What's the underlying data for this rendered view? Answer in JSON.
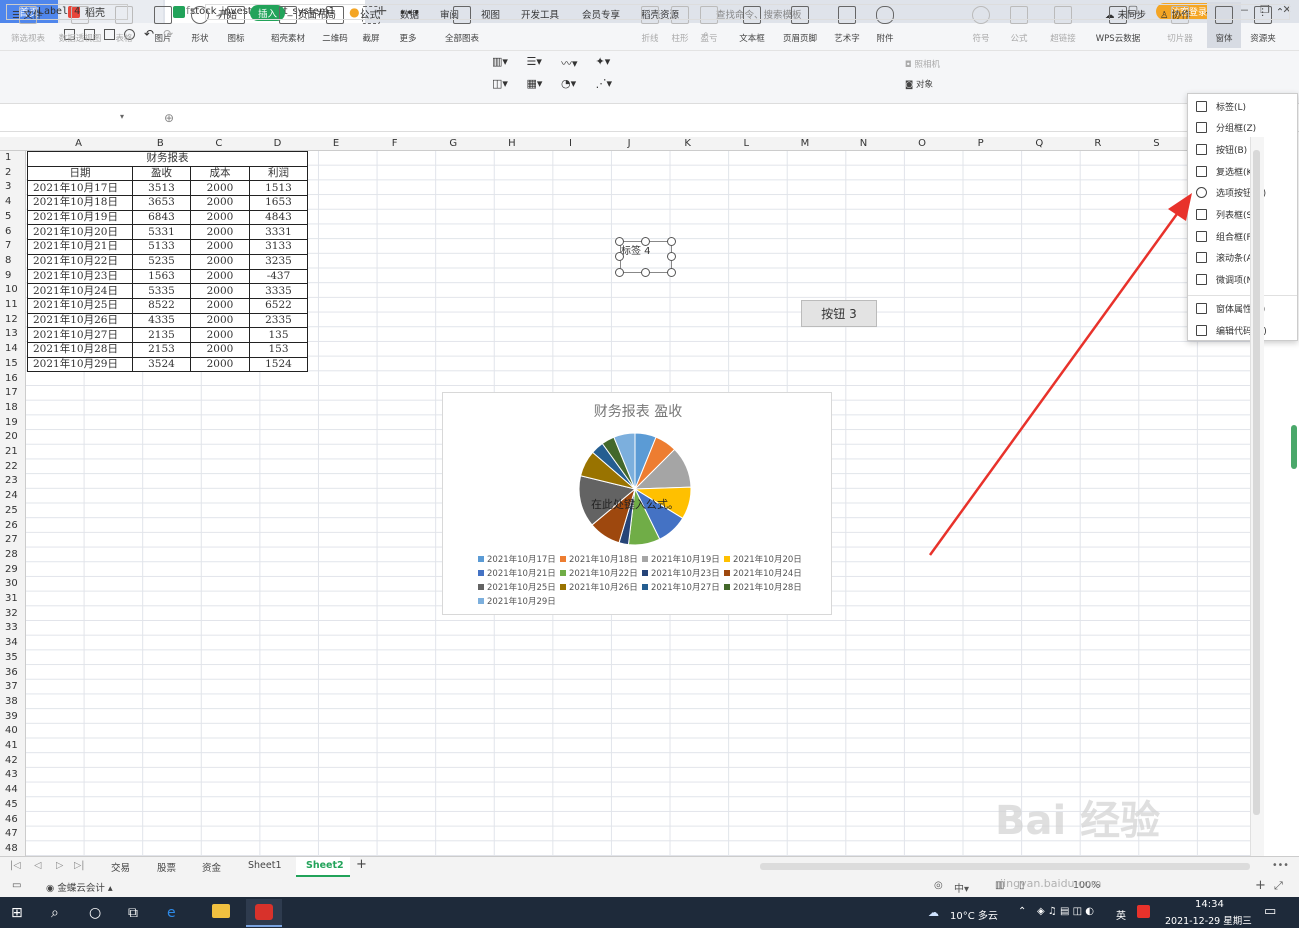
{
  "titlebar": {
    "tabs": [
      "首页",
      "稻壳",
      "stock_invest...ment_system1"
    ],
    "add": "+",
    "login": "访客登录",
    "win_controls": [
      "▢",
      "—",
      "❐",
      "✕"
    ]
  },
  "menubar": {
    "file": "☰ 文件",
    "items": [
      "开始",
      "插入",
      "页面布局",
      "公式",
      "数据",
      "审阅",
      "视图",
      "开发工具",
      "会员专享",
      "稻壳资源"
    ],
    "search": "查找命令、搜索模板",
    "right": [
      "未同步",
      "协作",
      "分享"
    ]
  },
  "ribbon": {
    "items": [
      "筛选视表",
      "数据透视图",
      "表格",
      "图片",
      "形状",
      "图标",
      "稻壳素材",
      "二维码",
      "截屏",
      "更多",
      "全部图表",
      "折线",
      "柱形",
      "盈亏",
      "文本框",
      "页眉页脚",
      "艺术字",
      "附件",
      "对象",
      "符号",
      "公式",
      "超链接",
      "WPS云数据",
      "切片器",
      "窗体",
      "资源夹"
    ],
    "camera": "照相机"
  },
  "formula_bar": {
    "name_box": "Label 4",
    "fx": "fx",
    "zoom_icon": "⊕"
  },
  "columns": [
    "A",
    "B",
    "C",
    "D",
    "E",
    "F",
    "G",
    "H",
    "I",
    "J",
    "K",
    "L",
    "M",
    "N",
    "O",
    "P",
    "Q",
    "R",
    "S"
  ],
  "rows": [
    "1",
    "2",
    "3",
    "4",
    "5",
    "6",
    "7",
    "8",
    "9",
    "10",
    "11",
    "12",
    "13",
    "14",
    "15",
    "16",
    "17",
    "18",
    "19",
    "20",
    "21",
    "22",
    "23",
    "24",
    "25",
    "26",
    "27",
    "28",
    "29",
    "30",
    "31",
    "32",
    "33",
    "34",
    "35",
    "36",
    "37",
    "38",
    "39",
    "40",
    "41",
    "42",
    "43",
    "44",
    "45",
    "46",
    "47",
    "48"
  ],
  "table": {
    "title": "财务报表",
    "headers": [
      "日期",
      "盈收",
      "成本",
      "利润"
    ],
    "rows": [
      [
        "2021年10月17日",
        "3513",
        "2000",
        "1513"
      ],
      [
        "2021年10月18日",
        "3653",
        "2000",
        "1653"
      ],
      [
        "2021年10月19日",
        "6843",
        "2000",
        "4843"
      ],
      [
        "2021年10月20日",
        "5331",
        "2000",
        "3331"
      ],
      [
        "2021年10月21日",
        "5133",
        "2000",
        "3133"
      ],
      [
        "2021年10月22日",
        "5235",
        "2000",
        "3235"
      ],
      [
        "2021年10月23日",
        "1563",
        "2000",
        "-437"
      ],
      [
        "2021年10月24日",
        "5335",
        "2000",
        "3335"
      ],
      [
        "2021年10月25日",
        "8522",
        "2000",
        "6522"
      ],
      [
        "2021年10月26日",
        "4335",
        "2000",
        "2335"
      ],
      [
        "2021年10月27日",
        "2135",
        "2000",
        "135"
      ],
      [
        "2021年10月28日",
        "2153",
        "2000",
        "153"
      ],
      [
        "2021年10月29日",
        "3524",
        "2000",
        "1524"
      ]
    ]
  },
  "controls": {
    "label4": "标签 4",
    "button3": "按钮 3"
  },
  "chart_data": {
    "type": "pie",
    "title": "财务报表 盈收",
    "annotation": "在此处键入公式。",
    "categories": [
      "2021年10月17日",
      "2021年10月18日",
      "2021年10月19日",
      "2021年10月20日",
      "2021年10月21日",
      "2021年10月22日",
      "2021年10月23日",
      "2021年10月24日",
      "2021年10月25日",
      "2021年10月26日",
      "2021年10月27日",
      "2021年10月28日",
      "2021年10月29日"
    ],
    "values": [
      3513,
      3653,
      6843,
      5331,
      5133,
      5235,
      1563,
      5335,
      8522,
      4335,
      2135,
      2153,
      3524
    ],
    "colors": [
      "#5b9bd5",
      "#ed7d31",
      "#a5a5a5",
      "#ffc000",
      "#4472c4",
      "#70ad47",
      "#264478",
      "#9e480e",
      "#636363",
      "#997300",
      "#255e91",
      "#43682b",
      "#7cafdd"
    ],
    "legend": "bottom"
  },
  "dropdown": {
    "items": [
      "标签(L)",
      "分组框(Z)",
      "按钮(B)",
      "复选框(K)",
      "选项按钮(O)",
      "列表框(S)",
      "组合框(F)",
      "滚动条(A)",
      "微调项(N)",
      "窗体属性(R)",
      "编辑代码(M)"
    ]
  },
  "sheets": {
    "nav": [
      "|◁",
      "◁",
      "▷",
      "▷|"
    ],
    "tabs": [
      "交易",
      "股票",
      "资金",
      "Sheet1",
      "Sheet2"
    ],
    "add": "+"
  },
  "statusbar": {
    "app": "金蝶云会计",
    "zoom": "100%"
  },
  "taskbar": {
    "weather": "10°C 多云",
    "lang": "英",
    "time": "14:34",
    "date": "2021-12-29 星期三"
  },
  "watermark": {
    "text": "Bai 经验",
    "url": "jingyan.baidu.com"
  }
}
